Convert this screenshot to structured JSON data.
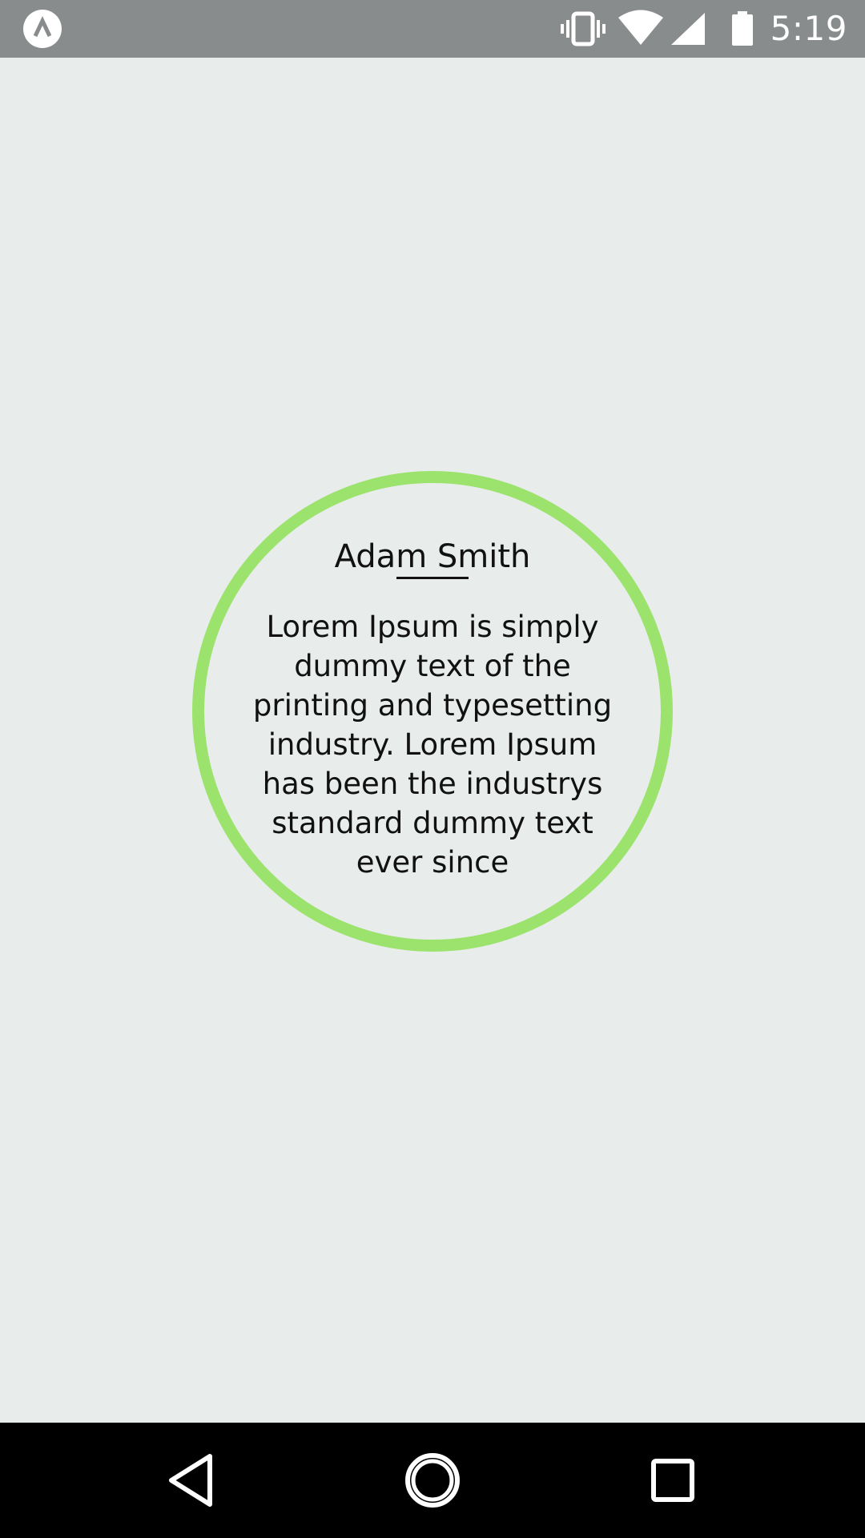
{
  "status_bar": {
    "time": "5:19",
    "icons": [
      "app-notification-icon",
      "vibrate-icon",
      "wifi-icon",
      "cell-signal-icon",
      "battery-icon"
    ]
  },
  "profile": {
    "name": "Adam Smith",
    "bio": "Lorem Ipsum is simply dummy text of the printing and typesetting industry. Lorem Ipsum has been the industrys standard dummy text ever since",
    "ring_color": "#9be36c"
  },
  "navigation": {
    "buttons": [
      "back-icon",
      "home-icon",
      "recents-icon"
    ]
  },
  "colors": {
    "status_bar": "#898c8d",
    "background": "#e8eceb",
    "nav_bar": "#000000"
  }
}
